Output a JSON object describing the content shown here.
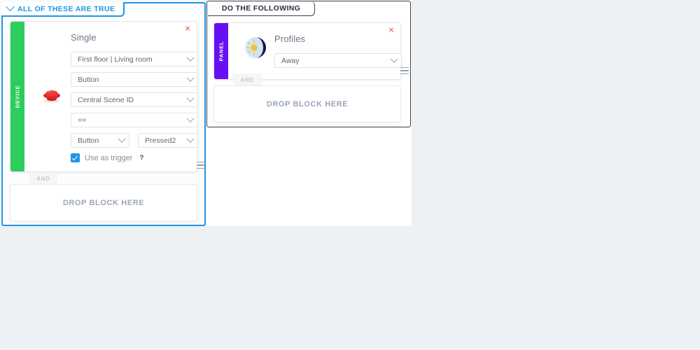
{
  "theme": {
    "page_background": "#edf1f4",
    "condition_accent": "#1e96e3",
    "action_accent": "#3a3f4b",
    "device_stripe": "#2ecc5d",
    "panel_stripe": "#6610f2",
    "close_color": "#f4402d",
    "dropzone_text": "#9aa6b6"
  },
  "condition_column": {
    "tab_label": "ALL OF THESE ARE TRUE",
    "chevron_icon": "chevron-down-icon",
    "block": {
      "stripe_label": "DEVICE",
      "icon": "red-push-button-icon",
      "title": "Single",
      "close_label": "×",
      "selects": {
        "room": "First floor | Living room",
        "device": "Button",
        "property": "Central Scene ID",
        "operator": "==",
        "value_a": "Button",
        "value_b": "Pressed2"
      },
      "trigger": {
        "checked": true,
        "label": "Use as trigger",
        "help_label": "?"
      },
      "menu_icon": "hamburger-menu-icon"
    },
    "connector_label": "AND",
    "dropzone_label": "DROP BLOCK HERE"
  },
  "action_column": {
    "tab_label": "DO THE FOLLOWING",
    "block": {
      "stripe_label": "PANEL",
      "icon": "day-night-profile-icon",
      "title": "Profiles",
      "close_label": "×",
      "selects": {
        "profile": "Away"
      },
      "menu_icon": "hamburger-menu-icon"
    },
    "connector_label": "AND",
    "dropzone_label": "DROP BLOCK HERE"
  }
}
